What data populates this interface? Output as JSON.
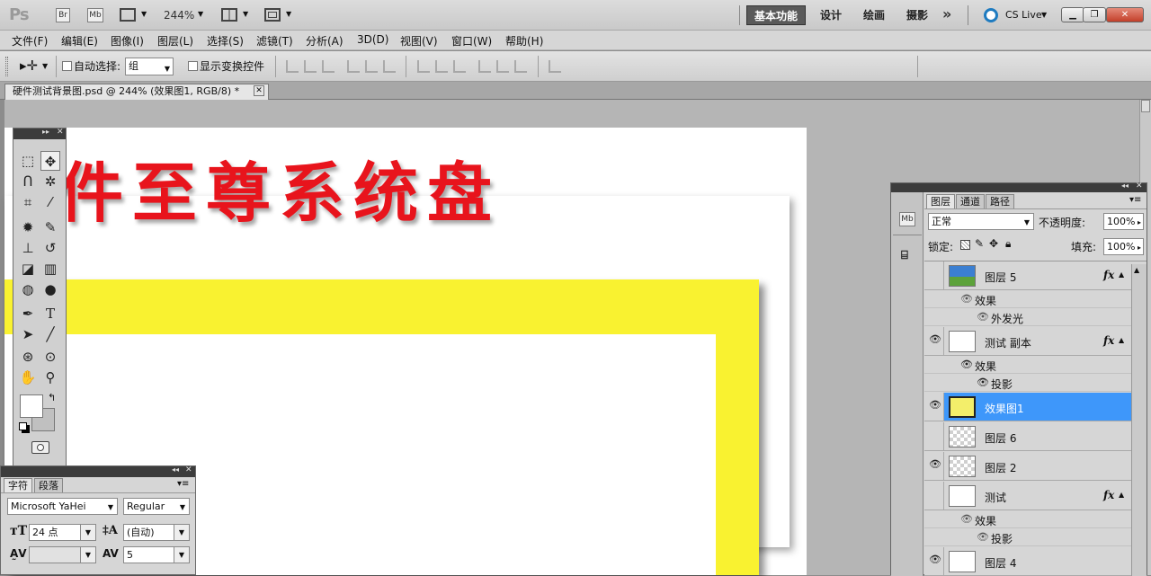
{
  "app": {
    "logo": "Ps",
    "bridge_btn": "Br",
    "minibridge_btn": "Mb",
    "zoom_display": "244%",
    "workspaces": [
      "基本功能",
      "设计",
      "绘画",
      "摄影"
    ],
    "more": "»",
    "cslive": "CS Live"
  },
  "window_controls": [
    "minimize-icon",
    "restore-icon",
    "close-icon"
  ],
  "menus": [
    "文件(F)",
    "编辑(E)",
    "图像(I)",
    "图层(L)",
    "选择(S)",
    "滤镜(T)",
    "分析(A)",
    "3D(D)",
    "视图(V)",
    "窗口(W)",
    "帮助(H)"
  ],
  "options": {
    "auto_select_label": "自动选择:",
    "auto_select_value": "组",
    "show_transform_label": "显示变换控件"
  },
  "document": {
    "tab_title": "硬件测试背景图.psd @ 244% (效果图1, RGB/8) *",
    "canvas_text": "件至尊系统盘"
  },
  "character_panel": {
    "tabs": [
      "字符",
      "段落"
    ],
    "font_family": "Microsoft YaHei",
    "font_style": "Regular",
    "font_size": "24 点",
    "leading": "(自动)",
    "kerning": "",
    "tracking": "5"
  },
  "layers_panel": {
    "tabs": [
      "图层",
      "通道",
      "路径"
    ],
    "blend_mode": "正常",
    "opacity_label": "不透明度:",
    "opacity": "100%",
    "lock_label": "锁定:",
    "fill_label": "填充:",
    "fill": "100%",
    "dock_labels": [
      "Mb"
    ],
    "layers": [
      {
        "name": "图层 5",
        "visible": false,
        "fx": true,
        "thumb": "sky",
        "effects_label": "效果",
        "effects": [
          "外发光"
        ]
      },
      {
        "name": "测试 副本",
        "visible": true,
        "fx": true,
        "thumb": "white",
        "effects_label": "效果",
        "effects": [
          "投影"
        ]
      },
      {
        "name": "效果图1",
        "visible": true,
        "fx": false,
        "thumb": "yellow",
        "selected": true
      },
      {
        "name": "图层 6",
        "visible": false,
        "fx": false,
        "thumb": "checker"
      },
      {
        "name": "图层 2",
        "visible": true,
        "fx": false,
        "thumb": "checker"
      },
      {
        "name": "测试",
        "visible": false,
        "fx": true,
        "thumb": "white",
        "effects_label": "效果",
        "effects": [
          "投影"
        ]
      },
      {
        "name": "图层 4",
        "visible": true,
        "fx": false,
        "thumb": "white"
      }
    ],
    "fx_label": "fx"
  },
  "colors": {
    "title_red": "#e8141c",
    "frame_yellow": "#f9f230",
    "selection_blue": "#3e97fa"
  }
}
